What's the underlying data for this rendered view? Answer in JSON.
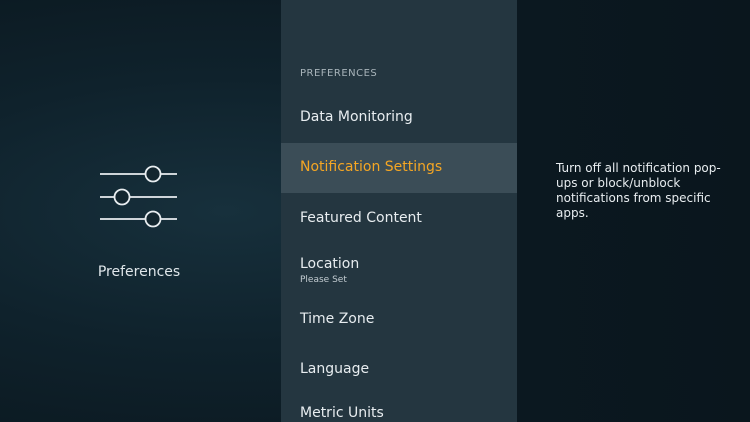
{
  "left": {
    "icon": "sliders-icon",
    "label": "Preferences"
  },
  "menu": {
    "header": "PREFERENCES",
    "items": [
      {
        "label": "Data Monitoring",
        "sub": ""
      },
      {
        "label": "Notification Settings",
        "sub": "",
        "selected": true
      },
      {
        "label": "Featured Content",
        "sub": ""
      },
      {
        "label": "Location",
        "sub": "Please Set"
      },
      {
        "label": "Time Zone",
        "sub": ""
      },
      {
        "label": "Language",
        "sub": ""
      },
      {
        "label": "Metric Units",
        "sub": ""
      }
    ]
  },
  "description": "Turn off all notification pop-ups or block/unblock notifications from specific apps.",
  "colors": {
    "accent": "#f5a623",
    "menu_bg": "#243640",
    "selected_bg": "#3b4d57",
    "background": "#0c1820"
  }
}
